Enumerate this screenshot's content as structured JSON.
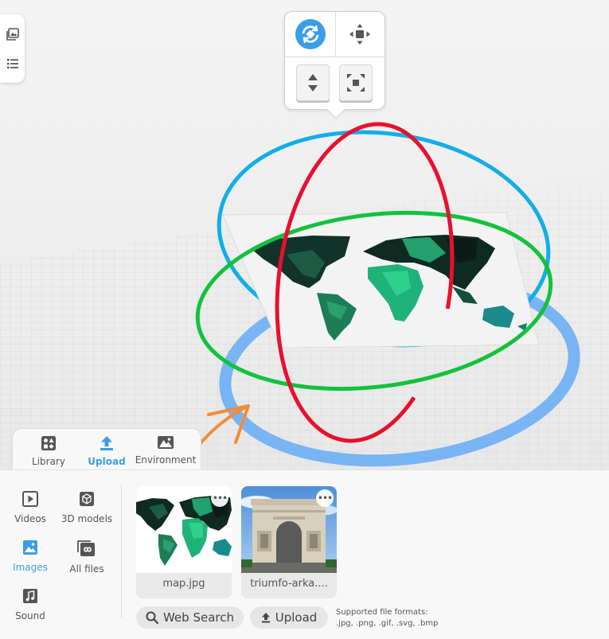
{
  "side_toolbar": {
    "icons": [
      "gallery-icon",
      "list-icon"
    ]
  },
  "transform_popover": {
    "buttons": [
      "rotate-icon",
      "move-icon",
      "vertical-move-icon",
      "scale-icon"
    ],
    "active": "rotate-icon",
    "accent": "#3a9ee6"
  },
  "scene": {
    "object": "world map image plane",
    "gizmo_colors": {
      "x_ring": "#e8102e",
      "y_ring": "#12c23c",
      "z_ring": "#12aee8",
      "ground_ring": "#73b1f4"
    },
    "drag_arrow_color": "#f28c3a"
  },
  "tabs": [
    {
      "label": "Library",
      "icon": "library-icon"
    },
    {
      "label": "Upload",
      "icon": "upload-icon",
      "active": true
    },
    {
      "label": "Environment",
      "icon": "environment-icon"
    }
  ],
  "categories": [
    {
      "label": "Videos",
      "icon": "video-icon"
    },
    {
      "label": "3D models",
      "icon": "cube-icon"
    },
    {
      "label": "Images",
      "icon": "image-icon",
      "active": true
    },
    {
      "label": "All files",
      "icon": "infinity-icon"
    },
    {
      "label": "Sound",
      "icon": "music-icon"
    }
  ],
  "assets": [
    {
      "name": "map.jpg",
      "kind": "world map"
    },
    {
      "name": "triumfo-arka....",
      "kind": "arc de triomphe photo"
    }
  ],
  "actions": {
    "web_search": "Web Search",
    "upload": "Upload"
  },
  "formats": {
    "line1": "Supported file formats:",
    "line2": ".jpg, .png, .gif, .svg, .bmp"
  }
}
